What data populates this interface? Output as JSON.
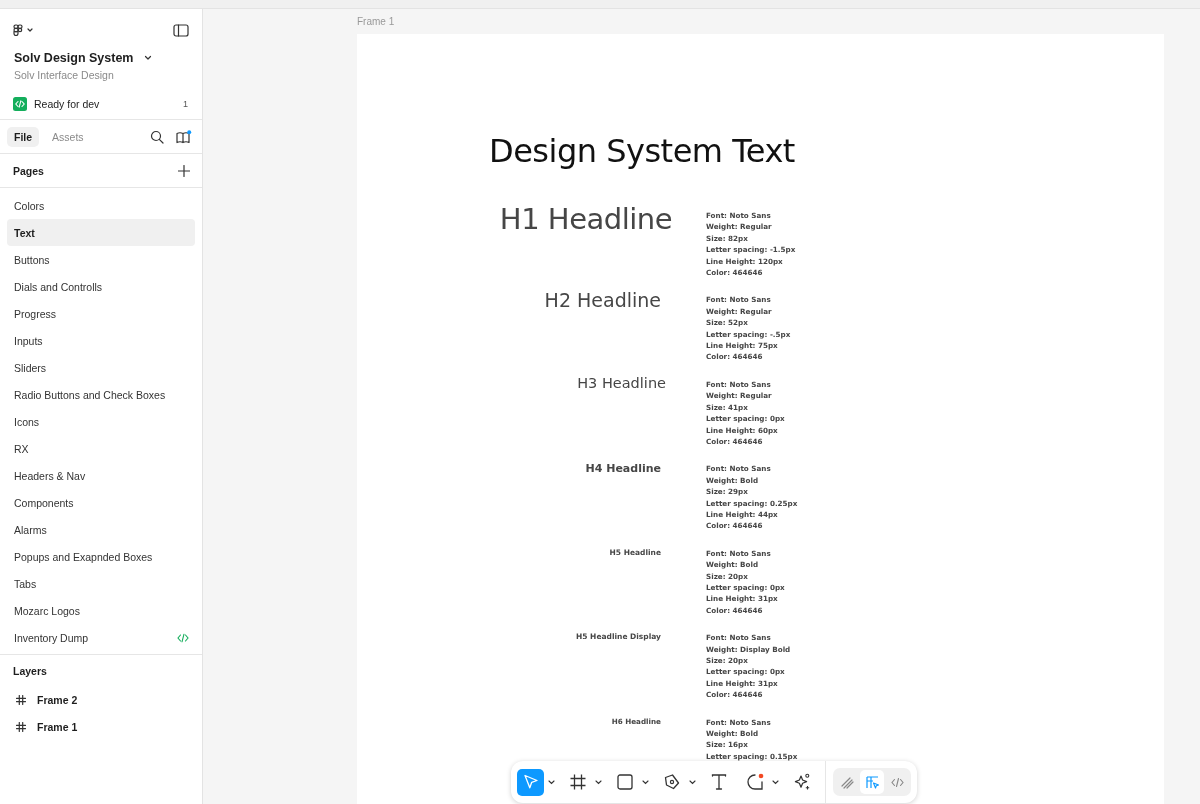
{
  "sidebar": {
    "project_title": "Solv Design System",
    "project_subtitle": "Solv Interface Design",
    "ready_for_dev": {
      "label": "Ready for dev",
      "count": "1"
    },
    "tabs": [
      {
        "label": "File",
        "selected": true
      },
      {
        "label": "Assets",
        "selected": false
      }
    ],
    "library_notification": true,
    "pages_header": "Pages",
    "pages": [
      {
        "label": "Colors",
        "selected": false,
        "ready_for_dev": false
      },
      {
        "label": "Text",
        "selected": true,
        "ready_for_dev": false
      },
      {
        "label": "Buttons",
        "selected": false,
        "ready_for_dev": false
      },
      {
        "label": "Dials and Controlls",
        "selected": false,
        "ready_for_dev": false
      },
      {
        "label": "Progress",
        "selected": false,
        "ready_for_dev": false
      },
      {
        "label": "Inputs",
        "selected": false,
        "ready_for_dev": false
      },
      {
        "label": "Sliders",
        "selected": false,
        "ready_for_dev": false
      },
      {
        "label": "Radio Buttons and Check Boxes",
        "selected": false,
        "ready_for_dev": false
      },
      {
        "label": "Icons",
        "selected": false,
        "ready_for_dev": false
      },
      {
        "label": "RX",
        "selected": false,
        "ready_for_dev": false
      },
      {
        "label": "Headers & Nav",
        "selected": false,
        "ready_for_dev": false
      },
      {
        "label": "Components",
        "selected": false,
        "ready_for_dev": false
      },
      {
        "label": "Alarms",
        "selected": false,
        "ready_for_dev": false
      },
      {
        "label": "Popups and Exapnded Boxes",
        "selected": false,
        "ready_for_dev": false
      },
      {
        "label": "Tabs",
        "selected": false,
        "ready_for_dev": false
      },
      {
        "label": "Mozarc Logos",
        "selected": false,
        "ready_for_dev": false
      },
      {
        "label": "Inventory Dump",
        "selected": false,
        "ready_for_dev": true
      }
    ],
    "layers_header": "Layers",
    "layers": [
      {
        "label": "Frame 2",
        "selected": false
      },
      {
        "label": "Frame 1",
        "selected": false
      }
    ]
  },
  "canvas": {
    "frame_label": "Frame 1",
    "title": "Design System Text",
    "styles": [
      {
        "kind": "h1",
        "name": "H1 Headline",
        "specs": [
          "Font: Noto Sans",
          "Weight: Regular",
          "Size: 82px",
          "Letter spacing: -1.5px",
          "Line Height: 120px",
          "Color: 464646"
        ]
      },
      {
        "kind": "h2",
        "name": "H2 Headline",
        "specs": [
          "Font: Noto Sans",
          "Weight: Regular",
          "Size: 52px",
          "Letter spacing: -.5px",
          "Line Height: 75px",
          "Color: 464646"
        ]
      },
      {
        "kind": "h3",
        "name": "H3 Headline",
        "specs": [
          "Font: Noto Sans",
          "Weight: Regular",
          "Size: 41px",
          "Letter spacing: 0px",
          "Line Height: 60px",
          "Color: 464646"
        ]
      },
      {
        "kind": "h4",
        "name": "H4 Headline",
        "specs": [
          "Font: Noto Sans",
          "Weight: Bold",
          "Size: 29px",
          "Letter spacing: 0.25px",
          "Line Height: 44px",
          "Color: 464646"
        ]
      },
      {
        "kind": "h5",
        "name": "H5 Headline",
        "specs": [
          "Font: Noto Sans",
          "Weight: Bold",
          "Size: 20px",
          "Letter spacing: 0px",
          "Line Height: 31px",
          "Color: 464646"
        ]
      },
      {
        "kind": "h5",
        "name": "H5 Headline Display",
        "specs": [
          "Font: Noto Sans",
          "Weight: Display Bold",
          "Size: 20px",
          "Letter spacing: 0px",
          "Line Height: 31px",
          "Color: 464646"
        ]
      },
      {
        "kind": "h6",
        "name": "H6 Headline",
        "specs": [
          "Font: Noto Sans",
          "Weight: Bold",
          "Size: 16px",
          "Letter spacing: 0.15px"
        ]
      }
    ]
  },
  "toolbar": {
    "tools": [
      {
        "kind": "move",
        "selected": true,
        "has_menu": true,
        "notification": false
      },
      {
        "kind": "frame",
        "selected": false,
        "has_menu": true,
        "notification": false
      },
      {
        "kind": "shape",
        "selected": false,
        "has_menu": true,
        "notification": false
      },
      {
        "kind": "pen",
        "selected": false,
        "has_menu": true,
        "notification": false
      },
      {
        "kind": "text",
        "selected": false,
        "has_menu": false,
        "notification": false
      },
      {
        "kind": "comment",
        "selected": false,
        "has_menu": true,
        "notification": true
      },
      {
        "kind": "ai",
        "selected": false,
        "has_menu": false,
        "notification": false
      }
    ],
    "modes": [
      {
        "kind": "draw",
        "selected": false
      },
      {
        "kind": "design",
        "selected": true
      },
      {
        "kind": "dev",
        "selected": false
      }
    ]
  }
}
